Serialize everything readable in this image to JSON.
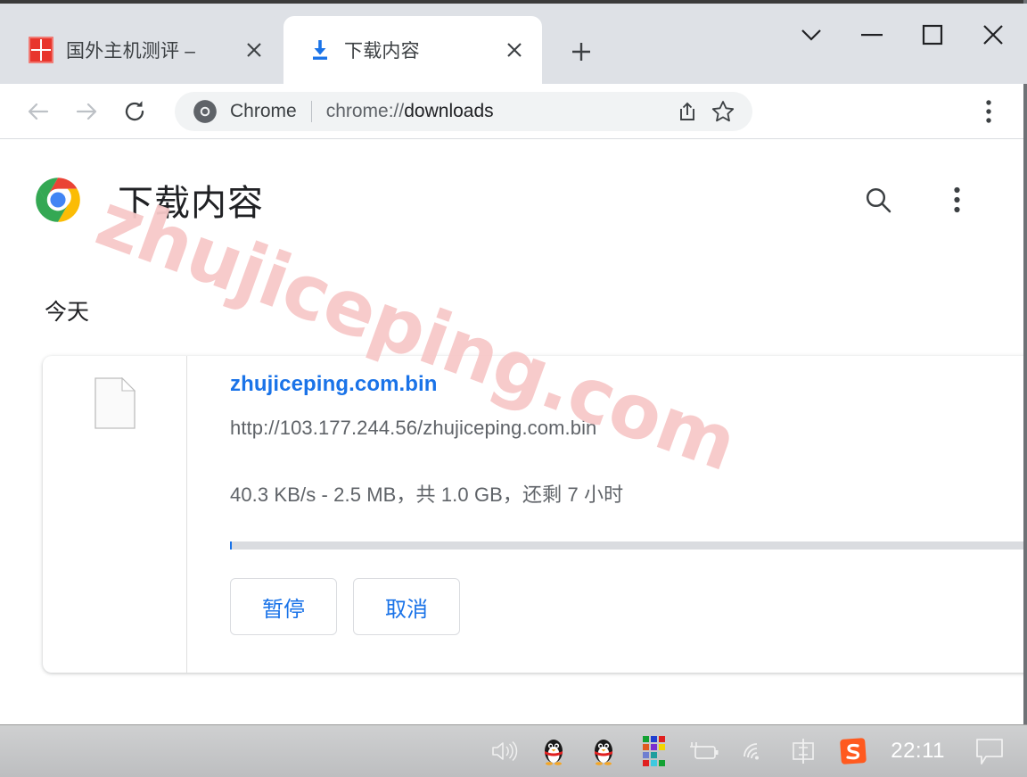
{
  "browser": {
    "tabs": [
      {
        "title": "国外主机测评 –",
        "favicon": "red-square-favicon",
        "active": false,
        "close_label": "×"
      },
      {
        "title": "下载内容",
        "favicon": "download-arrow-icon",
        "active": true,
        "close_label": "×"
      }
    ],
    "new_tab_label": "+",
    "window_controls": {
      "tab_search": "chevron-down-icon",
      "minimize": "minimize-icon",
      "maximize": "maximize-icon",
      "close": "close-icon"
    },
    "toolbar": {
      "back": "back-arrow-icon",
      "forward": "forward-arrow-icon",
      "reload": "reload-icon",
      "omnibox": {
        "scheme_icon": "chrome-logo-icon",
        "scheme_label": "Chrome",
        "url_prefix": "chrome://",
        "url_bold": "downloads",
        "share_icon": "share-icon",
        "bookmark_icon": "star-icon"
      },
      "menu_icon": "three-dot-menu-icon"
    }
  },
  "page": {
    "logo": "chrome-logo",
    "title": "下载内容",
    "search_icon": "search-icon",
    "menu_icon": "three-dot-menu-icon",
    "date_group": "今天",
    "watermark": "zhujiceping.com",
    "download": {
      "file_icon": "generic-file-icon",
      "filename": "zhujiceping.com.bin",
      "url": "http://103.177.244.56/zhujiceping.com.bin",
      "status": "40.3 KB/s - 2.5 MB，共 1.0 GB，还剩 7 小时",
      "progress_percent": 0.25,
      "buttons": {
        "pause": "暂停",
        "cancel": "取消"
      }
    }
  },
  "taskbar": {
    "items": [
      {
        "name": "volume-icon",
        "label": ""
      },
      {
        "name": "qq-penguin-icon",
        "label": ""
      },
      {
        "name": "qq-penguin-icon-2",
        "label": ""
      },
      {
        "name": "color-grid-icon",
        "label": ""
      },
      {
        "name": "battery-icon",
        "label": ""
      },
      {
        "name": "wifi-icon",
        "label": ""
      },
      {
        "name": "ime-chinese-icon",
        "label": "中"
      },
      {
        "name": "sogou-icon",
        "label": "S"
      }
    ],
    "clock": "22:11",
    "notification_icon": "notification-icon"
  },
  "colors": {
    "accent_blue": "#1a73e8",
    "tabstrip": "#dee1e6",
    "watermark_pink": "#f7c9c9",
    "taskbar": "#c4c5c7"
  }
}
